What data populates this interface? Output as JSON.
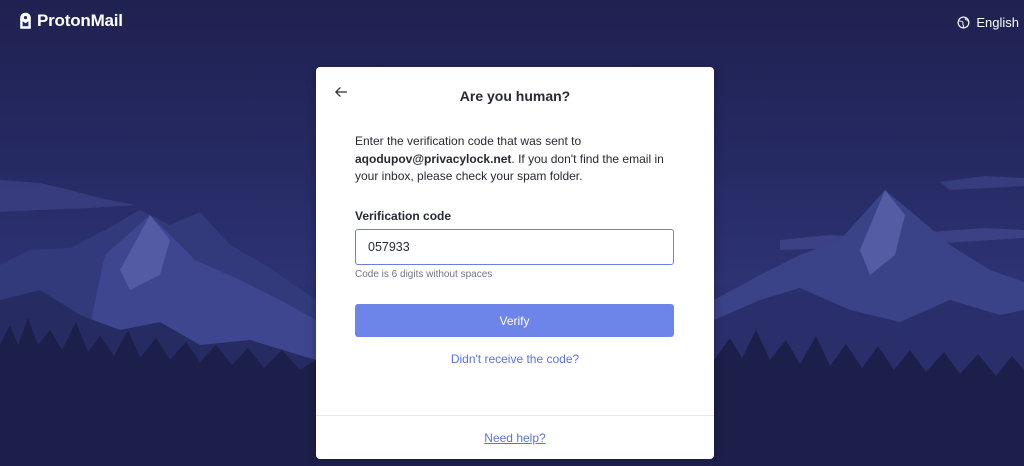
{
  "header": {
    "brand": "ProtonMail",
    "language": "English"
  },
  "card": {
    "title": "Are you human?",
    "description_prefix": "Enter the verification code that was sent to ",
    "email": "aqodupov@privacylock.net",
    "description_suffix": ". If you don't find the email in your inbox, please check your spam folder.",
    "field_label": "Verification code",
    "code_value": "057933",
    "hint": "Code is 6 digits without spaces",
    "verify_label": "Verify",
    "resend_label": "Didn't receive the code?",
    "help_label": "Need help?"
  },
  "colors": {
    "background": "#262a63",
    "accent": "#6d85e9",
    "link": "#5b73d8"
  },
  "icons": {
    "logo": "protonmail-logo-icon",
    "language": "globe-icon",
    "back": "arrow-left-icon"
  }
}
